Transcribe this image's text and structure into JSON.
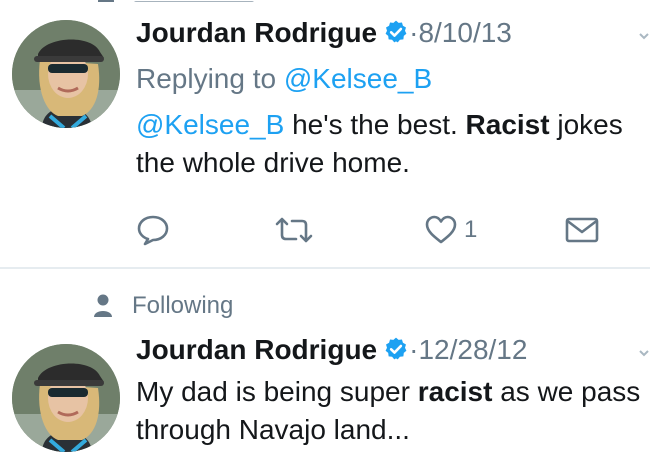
{
  "tweets": [
    {
      "author": "Jourdan Rodrigue",
      "separator": "·",
      "date": "8/10/13",
      "reply_prefix": "Replying to",
      "reply_handle": "@Kelsee_B",
      "text_mention": "@Kelsee_B",
      "text_part1": " he's the best. ",
      "text_bold": "Racist",
      "text_part2": " jokes the whole drive home.",
      "like_count": "1"
    },
    {
      "context": "Following",
      "author": "Jourdan Rodrigue",
      "separator": "·",
      "date": "12/28/12",
      "text_part1": "My dad is being super ",
      "text_bold": "racist",
      "text_part2": " as we pass through Navajo land..."
    }
  ],
  "colors": {
    "link": "#1da1f2",
    "verified": "#1da1f2",
    "meta": "#657786",
    "divider": "#e6ecf0"
  },
  "icons": {
    "verified": "verified-badge-icon",
    "reply": "reply-bubble-icon",
    "retweet": "retweet-icon",
    "like": "heart-icon",
    "dm": "envelope-icon",
    "context": "person-icon",
    "more": "chevron-down-icon"
  }
}
